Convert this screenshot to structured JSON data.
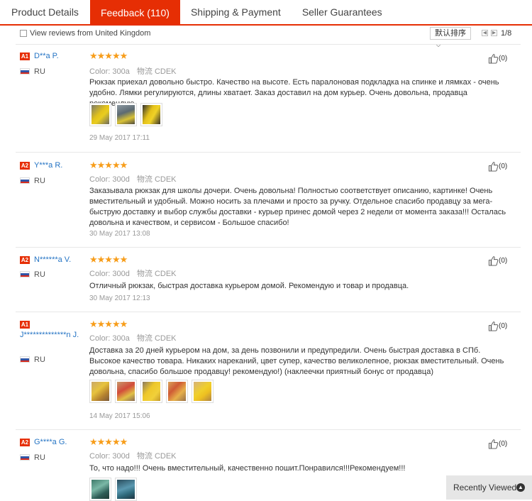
{
  "tabs": [
    "Product Details",
    "Feedback (110)",
    "Shipping & Payment",
    "Seller Guarantees"
  ],
  "filter": {
    "checkbox_label": "View reviews from United Kingdom",
    "sort_label": "默认排序",
    "page_text": "1/8"
  },
  "meta_labels": {
    "color": "Color:",
    "shipping": "物流"
  },
  "reviews": [
    {
      "level": "A1",
      "name": "D**a P.",
      "country": "RU",
      "stars": "★★★★★",
      "color": "300a",
      "logistics": "CDEK",
      "helpful": "(0)",
      "text": "Рюкзак приехал довольно быстро. Качество на высоте. Есть паралоновая подкладка на спинке и лямках - очень удобно. Лямки регулируются, длины хватает. Заказ доставил на дом курьер. Очень довольна, продавца рекомендую.",
      "date": "29 May 2017 17:11"
    },
    {
      "level": "A2",
      "name": "Y***a R.",
      "country": "RU",
      "stars": "★★★★★",
      "color": "300d",
      "logistics": "CDEK",
      "helpful": "(0)",
      "text": "Заказывала рюкзак для школы дочери. Очень довольна! Полностью соответствует описанию, картинке! Очень вместительный и удобный. Можно носить за плечами и просто за ручку. Отдельное спасибо продавцу за мега-быструю доставку и выбор службы доставки - курьер принес домой через 2 недели от момента заказа!!! Осталась довольна и качеством, и сервисом - Большое спасибо!",
      "date": "30 May 2017 13:08"
    },
    {
      "level": "A2",
      "name": "N******a V.",
      "country": "RU",
      "stars": "★★★★★",
      "color": "300d",
      "logistics": "CDEK",
      "helpful": "(0)",
      "text": "Отличный рюкзак, быстрая доставка курьером домой. Рекомендую и товар и продавца.",
      "date": "30 May 2017 12:13"
    },
    {
      "level": "A1",
      "name": "J**************n J.",
      "country": "RU",
      "stars": "★★★★★",
      "color": "300a",
      "logistics": "CDEK",
      "helpful": "(0)",
      "text": "Доставка за 20 дней курьером на дом, за день позвонили и предупредили. Очень быстрая доставка в СПб. Высокое качество товара. Никаких нареканий, цвет супер, качество великолепное, рюкзак вместительный. Очень довольна, спасибо большое продавцу! рекомендую!) (наклеечки приятный бонус от продавца)",
      "date": "14 May 2017 15:06"
    },
    {
      "level": "A2",
      "name": "G****a G.",
      "country": "RU",
      "stars": "★★★★★",
      "color": "300d",
      "logistics": "CDEK",
      "helpful": "(0)",
      "text": "То, что надо!!! Очень вместительный, качественно пошит.Понравился!!!Рекомендуем!!!"
    }
  ],
  "recently_viewed": "Recently Viewed",
  "colors": {
    "accent": "#e62e04",
    "star": "#f79d1a",
    "link": "#2574c4"
  }
}
